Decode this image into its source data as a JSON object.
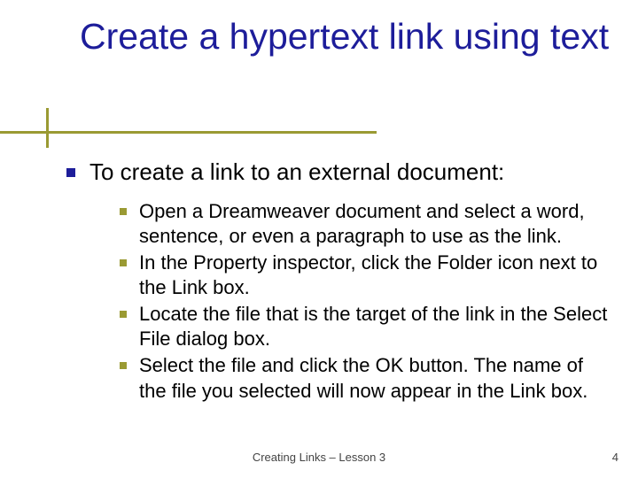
{
  "title": "Create a hypertext link using text",
  "lead": "To create a link to an external document:",
  "steps": [
    "Open a Dreamweaver document and select a word, sentence, or even a paragraph to use as the link.",
    "In the Property inspector, click the Folder icon next to the Link box.",
    "Locate the file that is the target of the link in the Select File dialog box.",
    "Select the file and click the OK button. The name of the file you selected will now appear in the Link box."
  ],
  "footer": "Creating Links – Lesson 3",
  "page_number": "4"
}
